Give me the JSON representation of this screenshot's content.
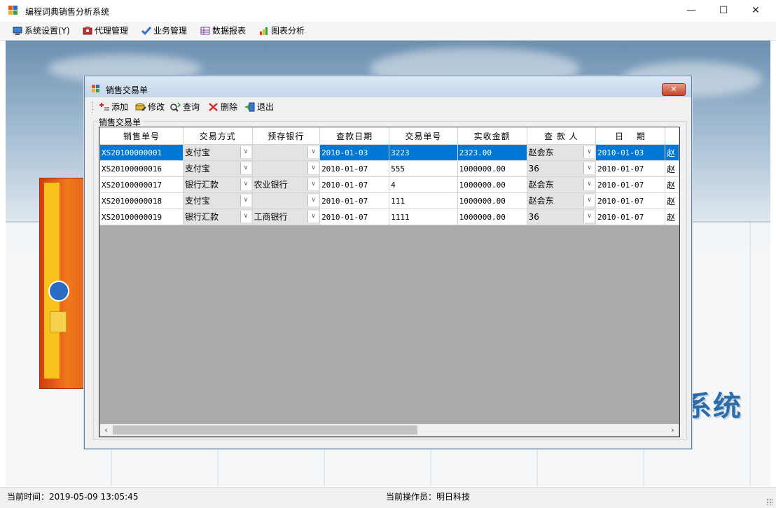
{
  "window": {
    "title": "编程词典销售分析系统",
    "controls": {
      "minimize": "—",
      "maximize": "☐",
      "close": "✕"
    }
  },
  "menu": [
    {
      "label": "系统设置(Y)",
      "icon": "monitor-icon"
    },
    {
      "label": "代理管理",
      "icon": "agent-icon"
    },
    {
      "label": "业务管理",
      "icon": "checkmark-icon"
    },
    {
      "label": "数据报表",
      "icon": "table-icon"
    },
    {
      "label": "图表分析",
      "icon": "bar-chart-icon"
    }
  ],
  "background": {
    "brand_text": "系统"
  },
  "child": {
    "title": "销售交易单",
    "close_glyph": "✕",
    "toolbar": [
      {
        "label": "添加",
        "icon": "add-icon"
      },
      {
        "label": "修改",
        "icon": "edit-icon"
      },
      {
        "label": "查询",
        "icon": "search-icon"
      },
      {
        "label": "删除",
        "icon": "delete-icon"
      },
      {
        "label": "退出",
        "icon": "exit-icon"
      }
    ],
    "group_label": "销售交易单",
    "grid": {
      "columns": [
        "销售单号",
        "交易方式",
        "预存银行",
        "查款日期",
        "交易单号",
        "实收金额",
        "查 款 人",
        "日　 期",
        ""
      ],
      "rows": [
        [
          "XS20100000001",
          "支付宝",
          "",
          "2010-01-03",
          "3223",
          "2323.00",
          "赵会东",
          "2010-01-03",
          "赵"
        ],
        [
          "XS20100000016",
          "支付宝",
          "",
          "2010-01-07",
          "555",
          "1000000.00",
          "36",
          "2010-01-07",
          "赵"
        ],
        [
          "XS20100000017",
          "银行汇款",
          "农业银行",
          "2010-01-07",
          "4",
          "1000000.00",
          "赵会东",
          "2010-01-07",
          "赵"
        ],
        [
          "XS20100000018",
          "支付宝",
          "",
          "2010-01-07",
          "111",
          "1000000.00",
          "赵会东",
          "2010-01-07",
          "赵"
        ],
        [
          "XS20100000019",
          "银行汇款",
          "工商银行",
          "2010-01-07",
          "1111",
          "1000000.00",
          "36",
          "2010-01-07",
          "赵"
        ]
      ],
      "selected_row": 0,
      "scroll": {
        "left": "‹",
        "right": "›"
      }
    }
  },
  "status": {
    "time": "当前时间：2019-05-09 13:05:45",
    "operator": "当前操作员：明日科技"
  }
}
